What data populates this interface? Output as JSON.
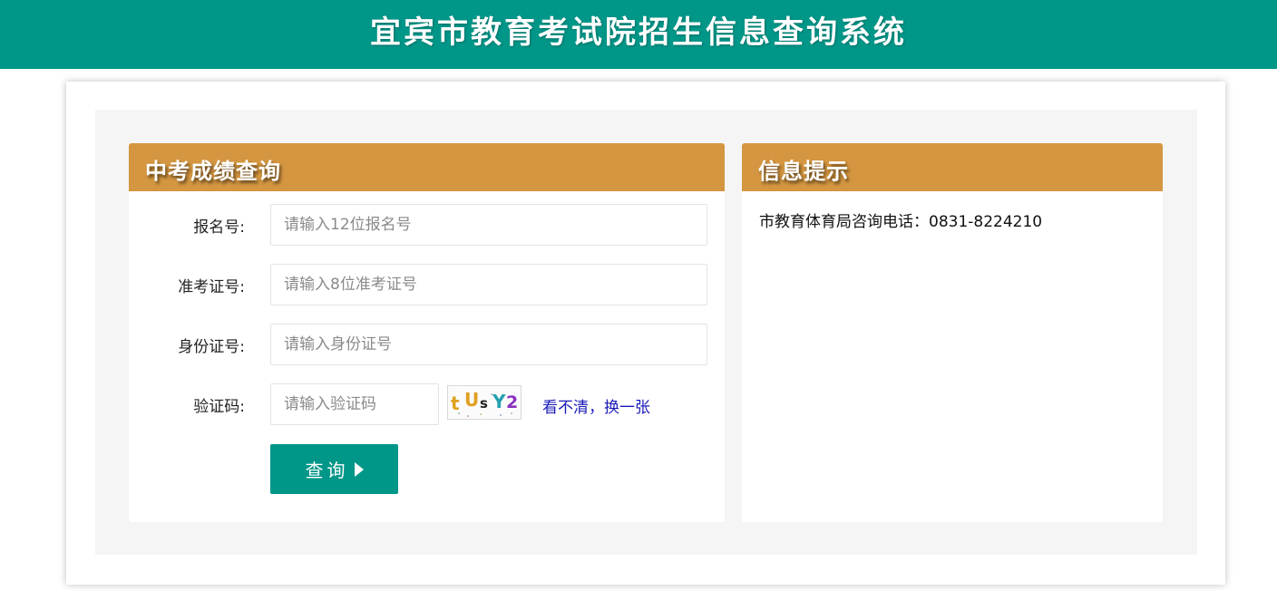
{
  "header": {
    "title": "宜宾市教育考试院招生信息查询系统"
  },
  "query_panel": {
    "title": "中考成绩查询",
    "fields": [
      {
        "label": "报名号:",
        "placeholder": "请输入12位报名号"
      },
      {
        "label": "准考证号:",
        "placeholder": "请输入8位准考证号"
      },
      {
        "label": "身份证号:",
        "placeholder": "请输入身份证号"
      },
      {
        "label": "验证码:",
        "placeholder": "请输入验证码"
      }
    ],
    "captcha_text": "tUsY2",
    "refresh_captcha_label": "看不清，换一张",
    "submit_label": "查询"
  },
  "info_panel": {
    "title": "信息提示",
    "text": "市教育体育局咨询电话：0831-8224210"
  },
  "colors": {
    "header_bg": "#009688",
    "panel_head_bg": "#d49640",
    "button_bg": "#009688",
    "link": "#1b1bb8"
  }
}
